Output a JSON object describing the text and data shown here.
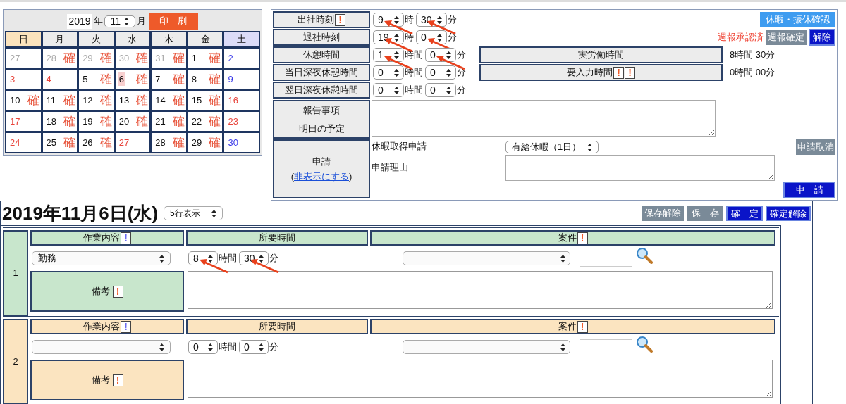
{
  "calendar": {
    "year": "2019",
    "year_unit": "年",
    "month": "11",
    "month_unit": "月",
    "print_button": "印　刷",
    "weekdays": [
      {
        "label": "日",
        "kind": "sunday"
      },
      {
        "label": "月",
        "kind": "weekday"
      },
      {
        "label": "火",
        "kind": "weekday"
      },
      {
        "label": "水",
        "kind": "weekday"
      },
      {
        "label": "木",
        "kind": "weekday"
      },
      {
        "label": "金",
        "kind": "weekday"
      },
      {
        "label": "土",
        "kind": "saturday"
      }
    ],
    "weeks": [
      [
        {
          "day": "27",
          "kind": "muted",
          "selected": false
        },
        {
          "day": "28",
          "kind": "muted",
          "mark": "確",
          "selected": false
        },
        {
          "day": "29",
          "kind": "muted",
          "mark": "確",
          "selected": false
        },
        {
          "day": "30",
          "kind": "muted",
          "mark": "確",
          "selected": false
        },
        {
          "day": "31",
          "kind": "muted",
          "mark": "確",
          "selected": false
        },
        {
          "day": "1",
          "kind": "normal",
          "mark": "確",
          "selected": false
        },
        {
          "day": "2",
          "kind": "blue",
          "selected": false
        }
      ],
      [
        {
          "day": "3",
          "kind": "red",
          "selected": false
        },
        {
          "day": "4",
          "kind": "red",
          "selected": false
        },
        {
          "day": "5",
          "kind": "normal",
          "mark": "確",
          "selected": false
        },
        {
          "day": "6",
          "kind": "normal",
          "mark": "確",
          "selected": true
        },
        {
          "day": "7",
          "kind": "normal",
          "mark": "確",
          "selected": false
        },
        {
          "day": "8",
          "kind": "normal",
          "mark": "確",
          "selected": false
        },
        {
          "day": "9",
          "kind": "blue",
          "selected": false
        }
      ],
      [
        {
          "day": "10",
          "kind": "normal",
          "mark": "確",
          "selected": false
        },
        {
          "day": "11",
          "kind": "normal",
          "mark": "確",
          "selected": false
        },
        {
          "day": "12",
          "kind": "normal",
          "mark": "確",
          "selected": false
        },
        {
          "day": "13",
          "kind": "normal",
          "mark": "確",
          "selected": false
        },
        {
          "day": "14",
          "kind": "normal",
          "mark": "確",
          "selected": false
        },
        {
          "day": "15",
          "kind": "normal",
          "mark": "確",
          "selected": false
        },
        {
          "day": "16",
          "kind": "red",
          "selected": false
        }
      ],
      [
        {
          "day": "17",
          "kind": "red",
          "selected": false
        },
        {
          "day": "18",
          "kind": "normal",
          "mark": "確",
          "selected": false
        },
        {
          "day": "19",
          "kind": "normal",
          "mark": "確",
          "selected": false
        },
        {
          "day": "20",
          "kind": "normal",
          "mark": "確",
          "selected": false
        },
        {
          "day": "21",
          "kind": "normal",
          "mark": "確",
          "selected": false
        },
        {
          "day": "22",
          "kind": "normal",
          "mark": "確",
          "selected": false
        },
        {
          "day": "23",
          "kind": "red",
          "selected": false
        }
      ],
      [
        {
          "day": "24",
          "kind": "red",
          "selected": false
        },
        {
          "day": "25",
          "kind": "normal",
          "mark": "確",
          "selected": false
        },
        {
          "day": "26",
          "kind": "normal",
          "mark": "確",
          "selected": false
        },
        {
          "day": "27",
          "kind": "red",
          "selected": false
        },
        {
          "day": "28",
          "kind": "normal",
          "mark": "確",
          "selected": false
        },
        {
          "day": "29",
          "kind": "normal",
          "mark": "確",
          "selected": false
        },
        {
          "day": "30",
          "kind": "blue",
          "selected": false
        }
      ]
    ]
  },
  "attendance": {
    "rows": [
      {
        "label": "出社時刻",
        "alerts": [
          {
            "text": "!",
            "color": "#f05a28"
          }
        ],
        "selects": [
          {
            "value": "9",
            "unit": "時",
            "arrow": true
          },
          {
            "value": "30",
            "unit": "分",
            "arrow": true
          }
        ]
      },
      {
        "label": "退社時刻",
        "selects": [
          {
            "value": "19",
            "unit": "時",
            "arrow": true
          },
          {
            "value": "0",
            "unit": "分",
            "arrow": true
          }
        ]
      },
      {
        "label": "休憩時間",
        "selects": [
          {
            "value": "1",
            "unit": "時間",
            "arrow": true
          },
          {
            "value": "0",
            "unit": "分",
            "arrow": true
          }
        ]
      },
      {
        "label": "当日深夜休憩時間",
        "selects": [
          {
            "value": "0",
            "unit": "時間",
            "arrow": false
          },
          {
            "value": "0",
            "unit": "分",
            "arrow": false
          }
        ]
      },
      {
        "label": "翌日深夜休憩時間",
        "selects": [
          {
            "value": "0",
            "unit": "時間",
            "arrow": false
          },
          {
            "value": "0",
            "unit": "分",
            "arrow": false
          }
        ]
      }
    ],
    "summary": [
      {
        "label": "実労働時間",
        "value": "8時間 30分"
      },
      {
        "label": "要入力時間",
        "alerts": [
          {
            "text": "!",
            "color": "#f05a28"
          },
          {
            "text": "!",
            "color": "#f05a28"
          }
        ],
        "value": "0時間 00分"
      }
    ],
    "vacation_check_button": "休暇・振休確認",
    "weekly_status": "週報承認済",
    "weekly_confirm_button": "週報確定",
    "release_button": "解除",
    "report_labels": [
      "報告事項",
      "明日の予定"
    ],
    "application": {
      "label": "申請",
      "paren_open": "(",
      "hide_link": "非表示にする",
      "paren_close": ")",
      "leave_label": "休暇取得申請",
      "leave_type": "有給休暇（1日）",
      "cancel_button": "申請取消",
      "reason_label": "申請理由",
      "submit_button": "申　請"
    }
  },
  "day_detail": {
    "title": "2019年11月6日(水)",
    "rows_select": "5行表示",
    "buttons": [
      {
        "label": "保存解除",
        "kind": "gray"
      },
      {
        "label": "保　存",
        "kind": "gray"
      },
      {
        "label": "確　定",
        "kind": "blue"
      },
      {
        "label": "確定解除",
        "kind": "blue"
      }
    ],
    "work_rows": [
      {
        "number": "1",
        "color": "#c8e6cc",
        "headers": [
          {
            "label": "作業内容",
            "alerts": [
              {
                "text": "!",
                "color": "#6c6cf0"
              }
            ]
          },
          {
            "label": "所要時間"
          },
          {
            "label": "案件",
            "alerts": [
              {
                "text": "!",
                "color": "#f05a28"
              }
            ]
          }
        ],
        "task": "勤務",
        "hours": {
          "value": "8",
          "unit": "時間",
          "arrow": true
        },
        "minutes": {
          "value": "30",
          "unit": "分",
          "arrow": true
        },
        "note_label": "備考",
        "note_alerts": [
          {
            "text": "!",
            "color": "#f05a28"
          }
        ]
      },
      {
        "number": "2",
        "color": "#fbe4c0",
        "headers": [
          {
            "label": "作業内容",
            "alerts": [
              {
                "text": "!",
                "color": "#6c6cf0"
              }
            ]
          },
          {
            "label": "所要時間"
          },
          {
            "label": "案件",
            "alerts": [
              {
                "text": "!",
                "color": "#f05a28"
              }
            ]
          }
        ],
        "hours": {
          "value": "0",
          "unit": "時間",
          "arrow": false
        },
        "minutes": {
          "value": "0",
          "unit": "分",
          "arrow": false
        },
        "note_label": "備考",
        "note_alerts": [
          {
            "text": "!",
            "color": "#f05a28"
          }
        ]
      }
    ]
  }
}
